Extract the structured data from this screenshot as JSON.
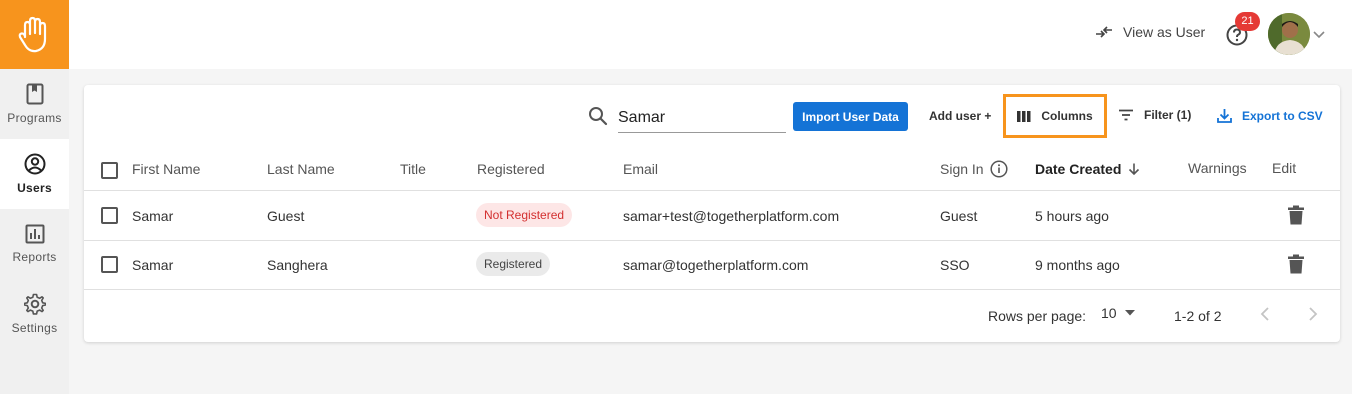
{
  "sidebar": {
    "items": [
      {
        "label": "Programs",
        "icon": "book-icon",
        "active": false
      },
      {
        "label": "Users",
        "icon": "user-circle-icon",
        "active": true
      },
      {
        "label": "Reports",
        "icon": "bar-chart-icon",
        "active": false
      },
      {
        "label": "Settings",
        "icon": "gear-icon",
        "active": false
      }
    ]
  },
  "header": {
    "view_as_user": "View as User",
    "notification_count": "21"
  },
  "toolbar": {
    "search_value": "Samar",
    "import_label": "Import User Data",
    "add_user_label": "Add user +",
    "columns_label": "Columns",
    "filter_label": "Filter (1)",
    "export_label": "Export to CSV"
  },
  "table": {
    "columns": {
      "first_name": "First Name",
      "last_name": "Last Name",
      "title": "Title",
      "registered": "Registered",
      "email": "Email",
      "sign_in": "Sign In",
      "date_created": "Date Created",
      "warnings": "Warnings",
      "edit": "Edit"
    },
    "rows": [
      {
        "first_name": "Samar",
        "last_name": "Guest",
        "title": "",
        "registered": "Not Registered",
        "email": "samar+test@togetherplatform.com",
        "sign_in": "Guest",
        "date_created": "5 hours ago",
        "warnings": ""
      },
      {
        "first_name": "Samar",
        "last_name": "Sanghera",
        "title": "",
        "registered": "Registered",
        "email": "samar@togetherplatform.com",
        "sign_in": "SSO",
        "date_created": "9 months ago",
        "warnings": ""
      }
    ]
  },
  "pagination": {
    "rows_per_page_label": "Rows per page:",
    "rows_per_page": "10",
    "range": "1-2 of 2"
  },
  "colors": {
    "brand_orange": "#f7941d",
    "primary_blue": "#1473d6",
    "badge_red": "#e53935"
  }
}
